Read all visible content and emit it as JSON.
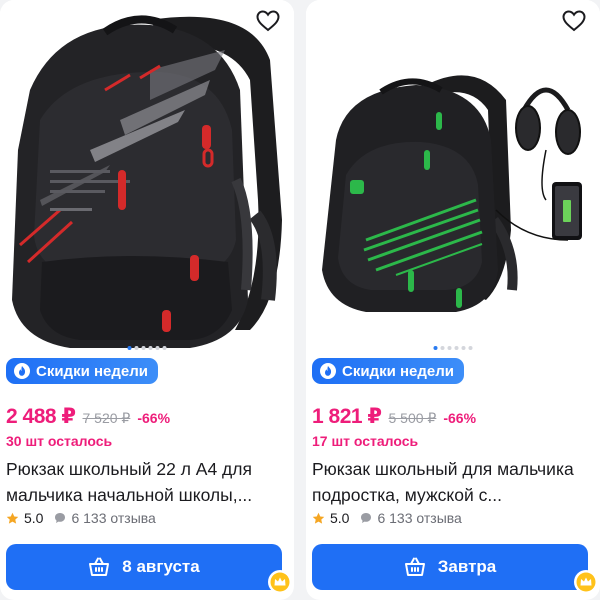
{
  "colors": {
    "accent": "#1f6ff5",
    "price": "#ee1d7a",
    "strike": "#9a9ca3",
    "star": "#f5a623"
  },
  "products": [
    {
      "badge": "Скидки недели",
      "price": "2 488 ₽",
      "old_price": "7 520 ₽",
      "discount": "-66%",
      "stock": "30 шт осталось",
      "title": "Рюкзак школьный 22 л A4 для мальчика начальной школы,...",
      "rating": "5.0",
      "reviews": "6 133 отзыва",
      "button": "8 августа",
      "image_index": 1,
      "image_count": 6
    },
    {
      "badge": "Скидки недели",
      "price": "1 821 ₽",
      "old_price": "5 500 ₽",
      "discount": "-66%",
      "stock": "17 шт осталось",
      "title": "Рюкзак школьный для мальчика подростка, мужской с...",
      "rating": "5.0",
      "reviews": "6 133 отзыва",
      "button": "Завтра",
      "image_index": 1,
      "image_count": 6
    }
  ],
  "icons": {
    "favorite": "heart-icon",
    "badge": "fire-icon",
    "rating": "star-icon",
    "reviews": "chat-bubble-icon",
    "cart": "basket-icon",
    "premium": "crown-icon"
  }
}
